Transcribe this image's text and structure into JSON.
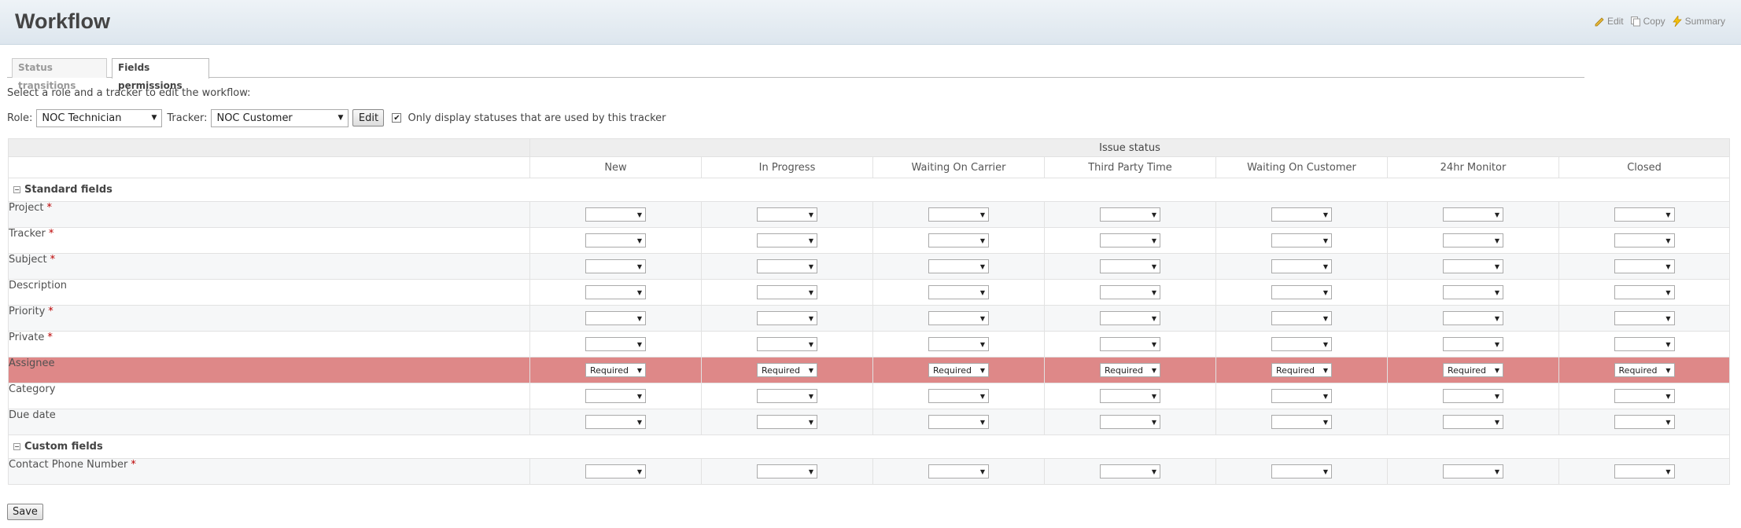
{
  "header": {
    "title": "Workflow",
    "actions": {
      "edit": "Edit",
      "copy": "Copy",
      "summary": "Summary"
    }
  },
  "tabs": [
    {
      "label": "Status transitions",
      "active": false
    },
    {
      "label": "Fields permissions",
      "active": true
    }
  ],
  "instruction": "Select a role and a tracker to edit the workflow:",
  "filter": {
    "role_label": "Role:",
    "role_value": "NOC Technician",
    "tracker_label": "Tracker:",
    "tracker_value": "NOC Customer",
    "edit_label": "Edit",
    "only_used_checked": true,
    "only_used_label": "Only display statuses that are used by this tracker"
  },
  "table": {
    "status_header": "Issue status",
    "statuses": [
      "New",
      "In Progress",
      "Waiting On Carrier",
      "Third Party Time",
      "Waiting On Customer",
      "24hr Monitor",
      "Closed"
    ],
    "groups": [
      {
        "label": "Standard fields",
        "fields": [
          {
            "name": "Project",
            "required": true,
            "value": ""
          },
          {
            "name": "Tracker",
            "required": true,
            "value": ""
          },
          {
            "name": "Subject",
            "required": true,
            "value": ""
          },
          {
            "name": "Description",
            "required": false,
            "value": ""
          },
          {
            "name": "Priority",
            "required": true,
            "value": ""
          },
          {
            "name": "Private",
            "required": true,
            "value": ""
          },
          {
            "name": "Assignee",
            "required": false,
            "value": "Required",
            "highlight": true
          },
          {
            "name": "Category",
            "required": false,
            "value": ""
          },
          {
            "name": "Due date",
            "required": false,
            "value": ""
          }
        ]
      },
      {
        "label": "Custom fields",
        "fields": [
          {
            "name": "Contact Phone Number",
            "required": true,
            "value": ""
          }
        ]
      }
    ]
  },
  "required_marker": "*",
  "save_label": "Save",
  "colors": {
    "highlight_row": "#de8888",
    "required_star": "#bb0000"
  }
}
